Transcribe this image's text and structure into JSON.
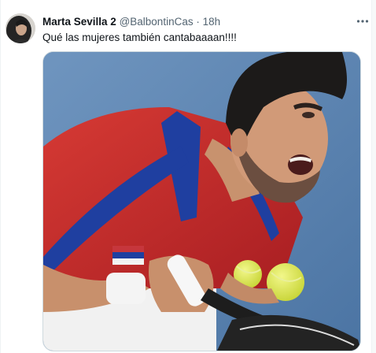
{
  "tweet": {
    "author_name": "Marta Sevilla 2",
    "author_handle": "@BalbontinCas",
    "separator": "·",
    "timestamp": "18h",
    "text": "Qué las mujeres también cantabaaaan!!!!",
    "more_icon": "more-horizontal-icon"
  },
  "media": {
    "type": "photo"
  },
  "colors": {
    "text_primary": "#0f1419",
    "text_secondary": "#536471",
    "border": "#cfd9de"
  }
}
